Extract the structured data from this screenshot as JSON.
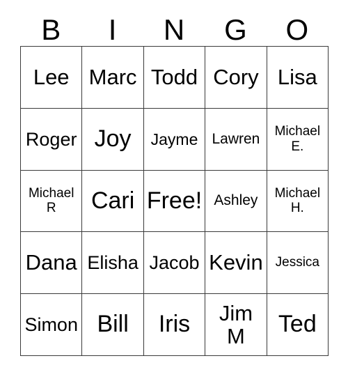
{
  "card": {
    "title": "BINGO",
    "header": {
      "letters": [
        "B",
        "I",
        "N",
        "G",
        "O"
      ]
    },
    "free_space_label": "Free!",
    "grid": {
      "columns": 5,
      "rows": 5,
      "cells": [
        [
          {
            "label": "Lee",
            "size": "fs-lg"
          },
          {
            "label": "Marc",
            "size": "fs-lg"
          },
          {
            "label": "Todd",
            "size": "fs-lg"
          },
          {
            "label": "Cory",
            "size": "fs-lg"
          },
          {
            "label": "Lisa",
            "size": "fs-lg"
          }
        ],
        [
          {
            "label": "Roger",
            "size": "fs-md"
          },
          {
            "label": "Joy",
            "size": "fs-xl"
          },
          {
            "label": "Jayme",
            "size": "fs-sm"
          },
          {
            "label": "Lawren",
            "size": "fs-xs"
          },
          {
            "label": "Michael\nE.",
            "size": "two-line"
          }
        ],
        [
          {
            "label": "Michael\nR",
            "size": "two-line"
          },
          {
            "label": "Cari",
            "size": "fs-xl"
          },
          {
            "label": "Free!",
            "size": "fs-xl"
          },
          {
            "label": "Ashley",
            "size": "fs-xs"
          },
          {
            "label": "Michael\nH.",
            "size": "two-line"
          }
        ],
        [
          {
            "label": "Dana",
            "size": "fs-lg"
          },
          {
            "label": "Elisha",
            "size": "fs-md"
          },
          {
            "label": "Jacob",
            "size": "fs-md"
          },
          {
            "label": "Kevin",
            "size": "fs-lg"
          },
          {
            "label": "Jessica",
            "size": "fs-xxs"
          }
        ],
        [
          {
            "label": "Simon",
            "size": "fs-md"
          },
          {
            "label": "Bill",
            "size": "fs-xl"
          },
          {
            "label": "Iris",
            "size": "fs-xl"
          },
          {
            "label": "Jim\nM",
            "size": "two-line-lg"
          },
          {
            "label": "Ted",
            "size": "fs-xl"
          }
        ]
      ]
    },
    "colors": {
      "background": "#ffffff",
      "text": "#000000",
      "border": "#3a3a3a"
    }
  }
}
